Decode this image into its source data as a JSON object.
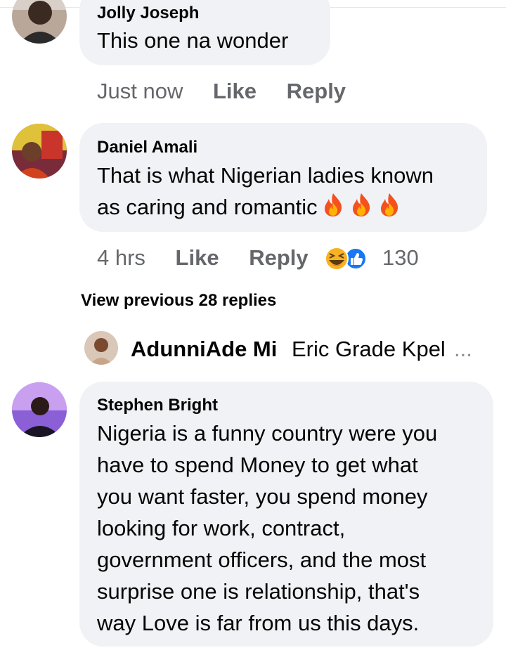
{
  "comments": [
    {
      "author": "Jolly Joseph",
      "text_lines": [
        "This one na wonder"
      ],
      "time": "Just now",
      "like_label": "Like",
      "reply_label": "Reply"
    },
    {
      "author": "Daniel Amali",
      "text_lines": [
        "That is what Nigerian ladies known",
        "as caring and romantic"
      ],
      "time": "4 hrs",
      "like_label": "Like",
      "reply_label": "Reply",
      "reactions": [
        "haha-icon",
        "like-icon"
      ],
      "reaction_count": "130",
      "emoji": [
        "fire-icon",
        "fire-icon",
        "fire-icon"
      ]
    },
    {
      "author": "Stephen Bright",
      "text_lines": [
        "Nigeria is a funny country were  you",
        "have to spend Money  to get what",
        "you want faster, you spend money",
        "looking for work, contract,",
        "government officers, and the most",
        "surprise one is relationship, that's",
        "way Love is far from us this days."
      ]
    }
  ],
  "view_previous": "View previous 28 replies",
  "reply_preview": {
    "author": "AdunniAde Mi",
    "text": "Eric Grade Kpel",
    "ellipsis": "..."
  },
  "colors": {
    "bubble": "#f0f2f5",
    "meta": "#65676b",
    "like_blue": "#1877f2",
    "haha_yellow": "#f7b125"
  }
}
